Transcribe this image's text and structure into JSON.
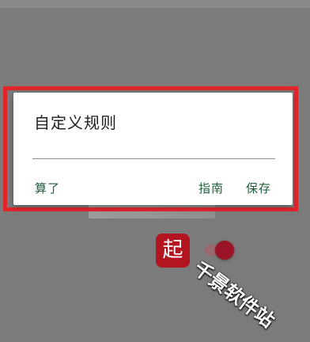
{
  "dialog": {
    "title": "自定义规则",
    "input_value": "",
    "buttons": {
      "cancel": "算了",
      "guide": "指南",
      "save": "保存"
    }
  },
  "background": {
    "app_icon_glyph": "起",
    "toggle_on": true
  },
  "watermark": "千景软件站",
  "colors": {
    "overlay": "#7b7b7b",
    "highlight": "#e0262b",
    "button_text": "#1f5c3a",
    "app_icon": "#b2151f",
    "toggle_thumb": "#9a1326"
  }
}
